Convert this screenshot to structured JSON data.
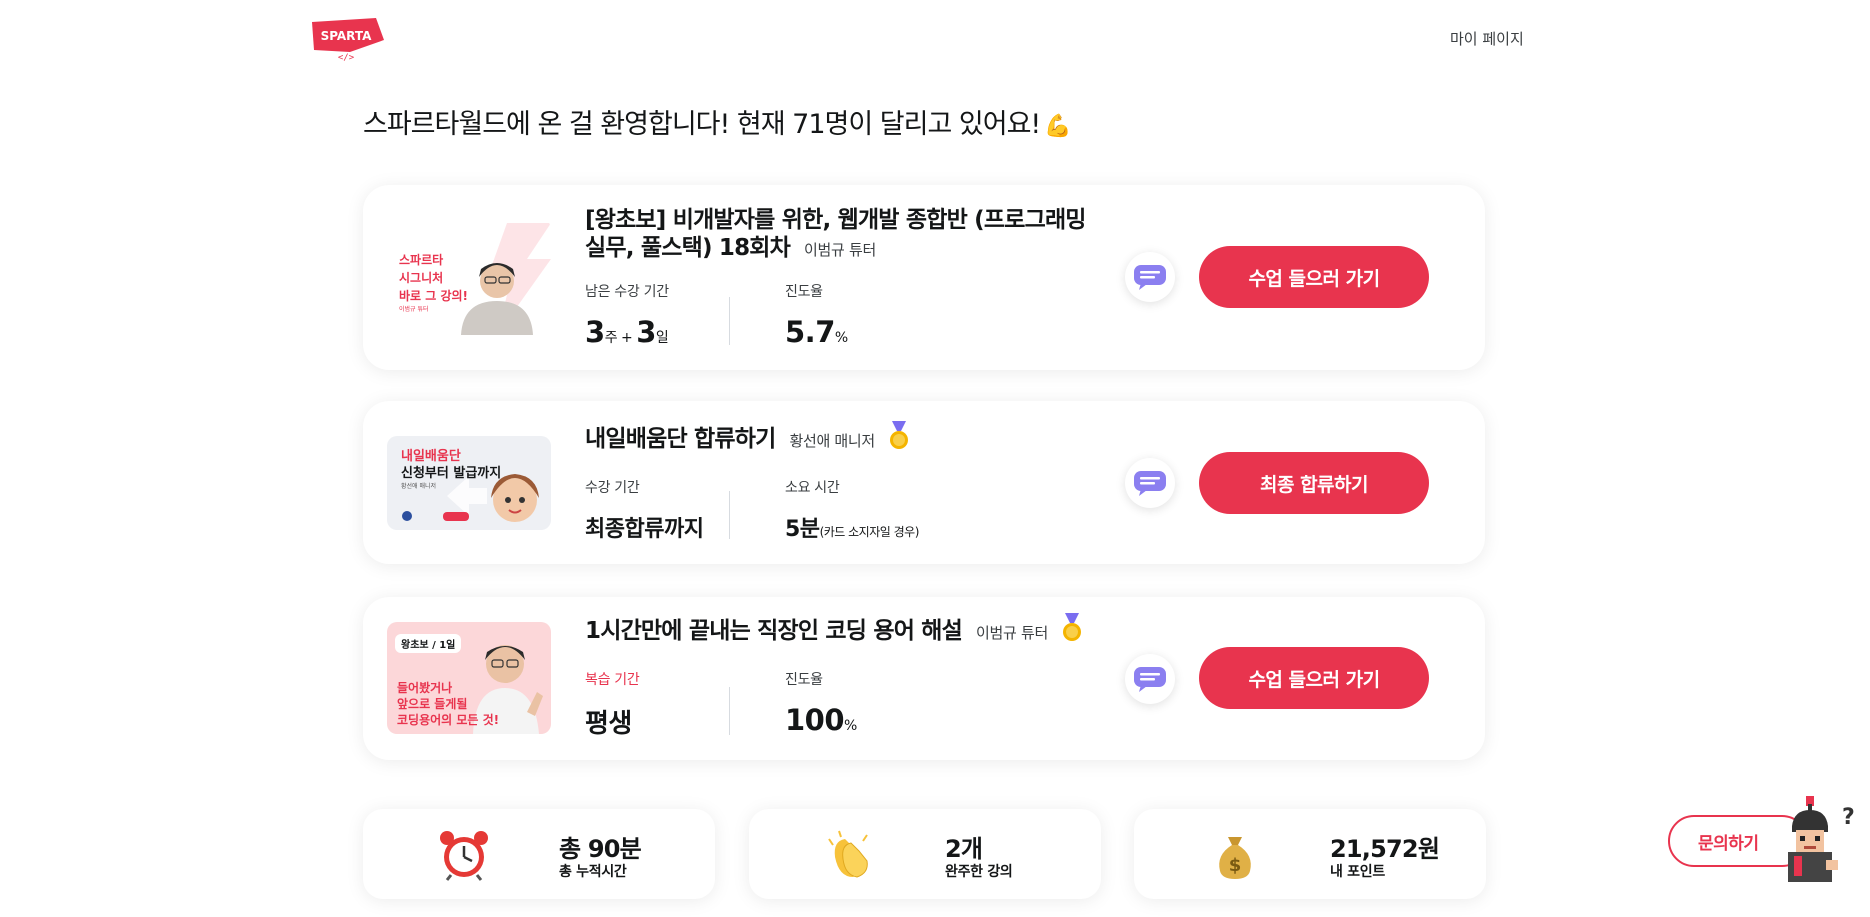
{
  "header": {
    "logo_text": "SPARTA",
    "mypage_label": "마이 페이지"
  },
  "welcome": {
    "text": "스파르타월드에 온 걸 환영합니다! 현재 71명이 달리고 있어요!",
    "emoji": "💪"
  },
  "courses": [
    {
      "title_line1": "[왕초보] 비개발자를 위한, 웹개발 종합반 (프로그래밍",
      "title_line2": "실무, 풀스택) 18회차",
      "tutor": "이범규 튜터",
      "thumb_text": [
        "스파르타",
        "시그니처",
        "바로 그 강의!"
      ],
      "thumb_tutor": "이범규 튜터",
      "stat1_label": "남은 수강 기간",
      "stat1_weeks": "3",
      "stat1_weeks_unit": "주 + ",
      "stat1_days": "3",
      "stat1_days_unit": "일",
      "stat2_label": "진도율",
      "stat2_value": "5.7",
      "stat2_unit": "%",
      "button_label": "수업 들으러 가기"
    },
    {
      "title": "내일배움단 합류하기",
      "tutor": "황선애 매니저",
      "thumb_text": [
        "내일배움단",
        "신청부터 발급까지",
        "황선애 매니저"
      ],
      "stat1_label": "수강 기간",
      "stat1_value": "최종합류까지",
      "stat2_label": "소요 시간",
      "stat2_value": "5분",
      "stat2_note": "(카드 소지자일 경우)",
      "button_label": "최종 합류하기"
    },
    {
      "title": "1시간만에 끝내는 직장인 코딩 용어 해설",
      "tutor": "이범규 튜터",
      "thumb_badge": "왕초보 / 1일",
      "thumb_text": [
        "들어봤거나",
        "앞으로 들게될",
        "코딩용어의 모든 것!"
      ],
      "stat1_label": "복습 기간",
      "stat1_value": "평생",
      "stat2_label": "진도율",
      "stat2_value": "100",
      "stat2_unit": "%",
      "button_label": "수업 들으러 가기"
    }
  ],
  "summary": [
    {
      "icon": "alarm-clock-icon",
      "value": "총 90분",
      "label": "총 누적시간"
    },
    {
      "icon": "clapping-hands-icon",
      "value": "2개",
      "label": "완주한 강의"
    },
    {
      "icon": "money-bag-icon",
      "value": "21,572원",
      "label": "내 포인트"
    }
  ],
  "inquiry_label": "문의하기",
  "colors": {
    "accent": "#e8344e",
    "chat_bubble": "#8b7ff0"
  }
}
